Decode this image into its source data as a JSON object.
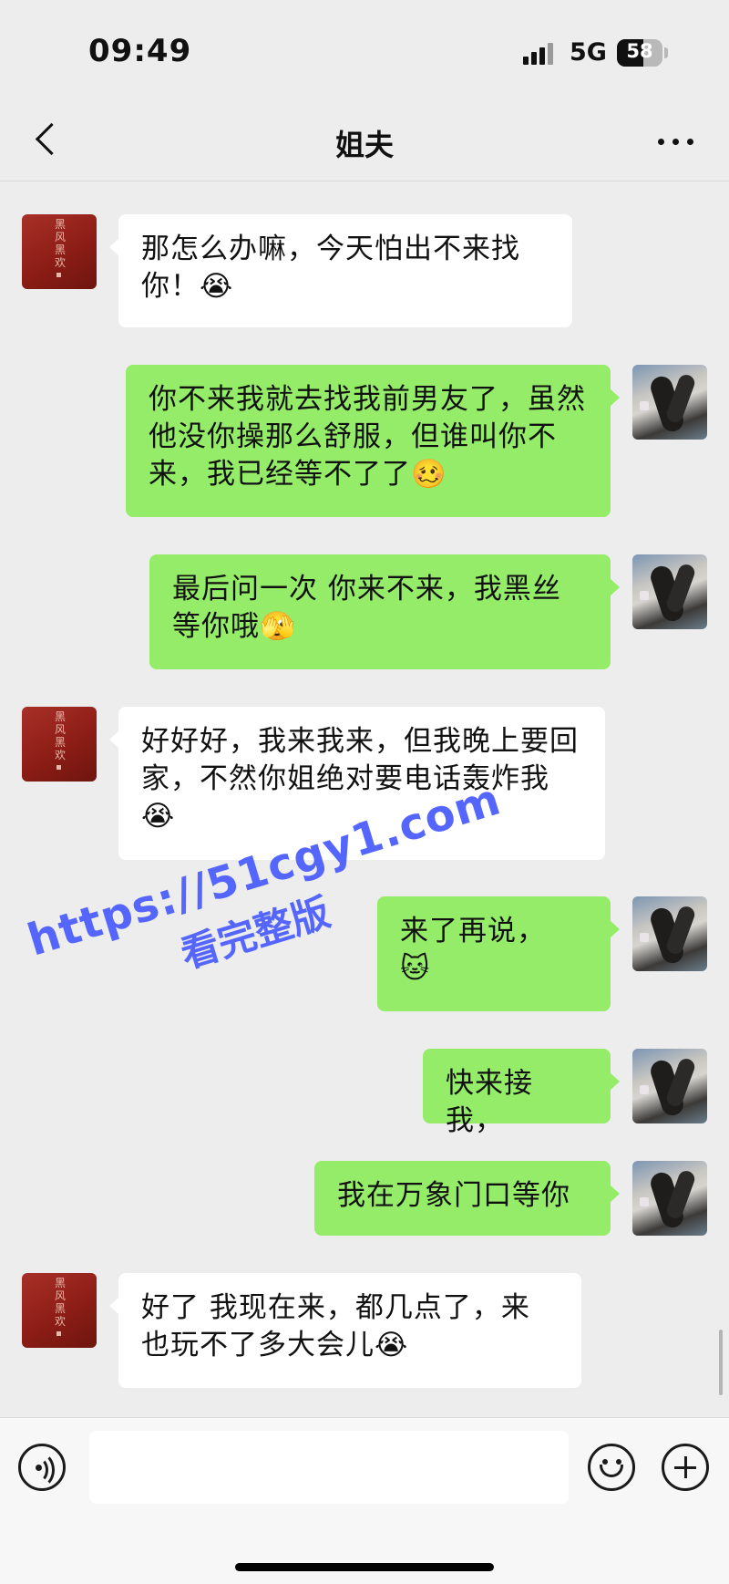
{
  "status_bar": {
    "time": "09:49",
    "network": "5G",
    "battery_level": "58",
    "battery_fraction": 0.58
  },
  "nav": {
    "title": "姐夫",
    "back_icon": "chevron-left-icon",
    "more_icon": "ellipsis-icon"
  },
  "contact_avatar_text": "黑风黑欢",
  "messages": [
    {
      "side": "left",
      "text": "那怎么办嘛，今天怕出不来找你！😭"
    },
    {
      "side": "right",
      "text": "你不来我就去找我前男友了，虽然他没你操那么舒服，但谁叫你不来，我已经等不了了🥴"
    },
    {
      "side": "right",
      "text": "最后问一次 你来不来，我黑丝等你哦🫣"
    },
    {
      "side": "left",
      "text": "好好好，我来我来，但我晚上要回家，不然你姐绝对要电话轰炸我😭"
    },
    {
      "side": "right",
      "text": "来了再说，\n🐱"
    },
    {
      "side": "right",
      "text": "快来接我，"
    },
    {
      "side": "right",
      "text": "我在万象门口等你"
    },
    {
      "side": "left",
      "text": "好了 我现在来，都几点了，来也玩不了多大会儿😭"
    }
  ],
  "watermark": {
    "url": "https://51cgy1.com",
    "subtitle": "看完整版"
  },
  "input_bar": {
    "placeholder": "",
    "voice_icon": "voice-icon",
    "emoji_icon": "emoji-icon",
    "plus_icon": "plus-icon"
  },
  "colors": {
    "background": "#ededed",
    "bubble_right": "#95ec69",
    "bubble_left": "#ffffff",
    "watermark": "#5566ff"
  }
}
